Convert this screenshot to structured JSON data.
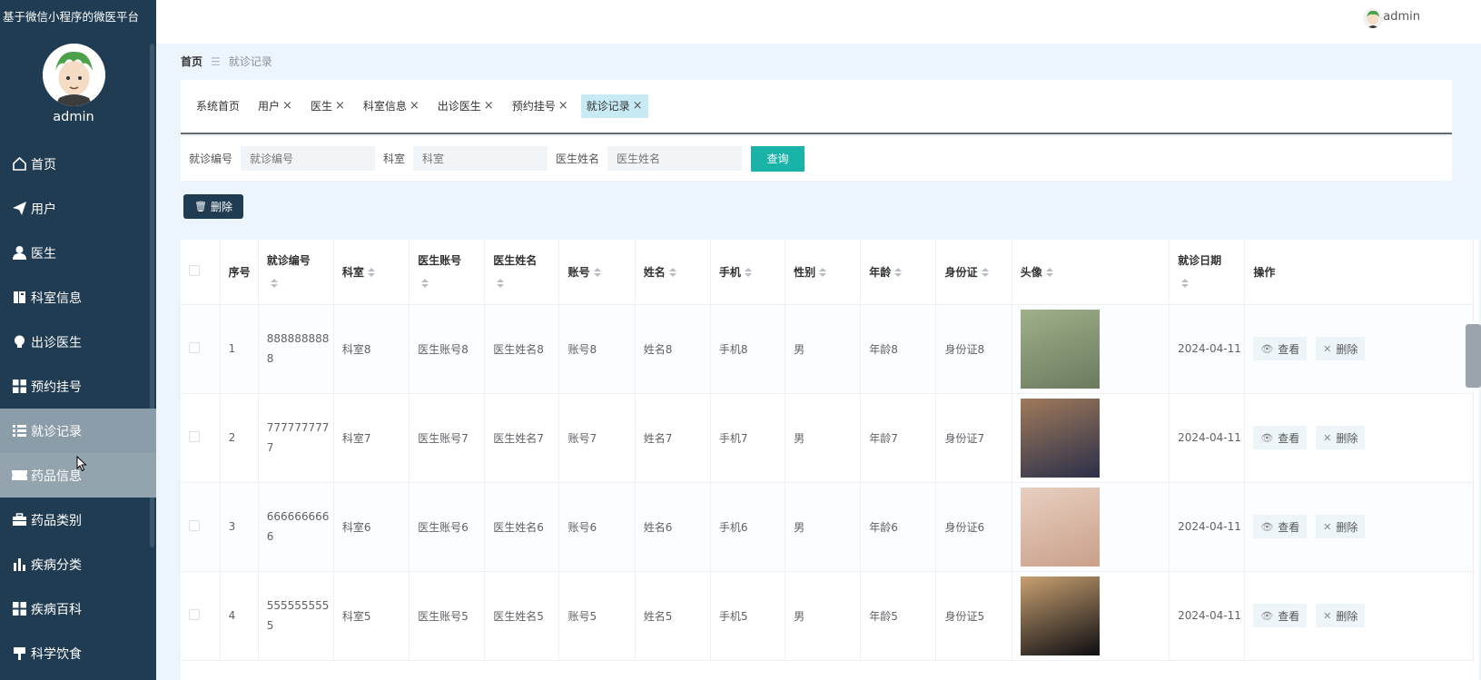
{
  "app": {
    "title": "基于微信小程序的微医平台"
  },
  "sidebar": {
    "username": "admin",
    "items": [
      {
        "label": "首页",
        "icon": "home-icon"
      },
      {
        "label": "用户",
        "icon": "paper-plane-icon"
      },
      {
        "label": "医生",
        "icon": "person-icon"
      },
      {
        "label": "科室信息",
        "icon": "book-icon"
      },
      {
        "label": "出诊医生",
        "icon": "bulb-icon"
      },
      {
        "label": "预约挂号",
        "icon": "grid-icon"
      },
      {
        "label": "就诊记录",
        "icon": "list-icon",
        "state": "active"
      },
      {
        "label": "药品信息",
        "icon": "ticket-icon",
        "state": "hover"
      },
      {
        "label": "药品类别",
        "icon": "briefcase-icon"
      },
      {
        "label": "疾病分类",
        "icon": "bar-chart-icon"
      },
      {
        "label": "疾病百科",
        "icon": "grid-icon"
      },
      {
        "label": "科学饮食",
        "icon": "flag-icon"
      }
    ]
  },
  "header": {
    "username": "admin"
  },
  "breadcrumb": {
    "home": "首页",
    "current": "就诊记录"
  },
  "tags": [
    {
      "label": "系统首页",
      "closable": false
    },
    {
      "label": "用户",
      "closable": true
    },
    {
      "label": "医生",
      "closable": true
    },
    {
      "label": "科室信息",
      "closable": true
    },
    {
      "label": "出诊医生",
      "closable": true
    },
    {
      "label": "预约挂号",
      "closable": true
    },
    {
      "label": "就诊记录",
      "closable": true,
      "active": true
    }
  ],
  "search": {
    "record_no_label": "就诊编号",
    "record_no_placeholder": "就诊编号",
    "dept_label": "科室",
    "dept_placeholder": "科室",
    "doctor_label": "医生姓名",
    "doctor_placeholder": "医生姓名",
    "query_label": "查询"
  },
  "toolbar": {
    "delete_label": "删除"
  },
  "table": {
    "columns": [
      "序号",
      "就诊编号",
      "科室",
      "医生账号",
      "医生姓名",
      "账号",
      "姓名",
      "手机",
      "性别",
      "年龄",
      "身份证",
      "头像",
      "就诊日期",
      "操作"
    ],
    "view_label": "查看",
    "delete_label": "删除",
    "rows": [
      {
        "index": "1",
        "record_no": "8888888888",
        "dept": "科室8",
        "doc_account": "医生账号8",
        "doc_name": "医生姓名8",
        "account": "账号8",
        "name": "姓名8",
        "phone": "手机8",
        "gender": "男",
        "age": "年龄8",
        "id_card": "身份证8",
        "date": "2024-04-11",
        "photo_colors": [
          "#6b7a5e",
          "#9fb08a"
        ]
      },
      {
        "index": "2",
        "record_no": "7777777777",
        "dept": "科室7",
        "doc_account": "医生账号7",
        "doc_name": "医生姓名7",
        "account": "账号7",
        "name": "姓名7",
        "phone": "手机7",
        "gender": "男",
        "age": "年龄7",
        "id_card": "身份证7",
        "date": "2024-04-11",
        "photo_colors": [
          "#2a2f4a",
          "#a07a5a"
        ]
      },
      {
        "index": "3",
        "record_no": "6666666666",
        "dept": "科室6",
        "doc_account": "医生账号6",
        "doc_name": "医生姓名6",
        "account": "账号6",
        "name": "姓名6",
        "phone": "手机6",
        "gender": "男",
        "age": "年龄6",
        "id_card": "身份证6",
        "date": "2024-04-11",
        "photo_colors": [
          "#c9a08a",
          "#e8cfc0"
        ]
      },
      {
        "index": "4",
        "record_no": "5555555555",
        "dept": "科室5",
        "doc_account": "医生账号5",
        "doc_name": "医生姓名5",
        "account": "账号5",
        "name": "姓名5",
        "phone": "手机5",
        "gender": "男",
        "age": "年龄5",
        "id_card": "身份证5",
        "date": "2024-04-11",
        "photo_colors": [
          "#0d0d12",
          "#c8a070"
        ]
      }
    ]
  }
}
